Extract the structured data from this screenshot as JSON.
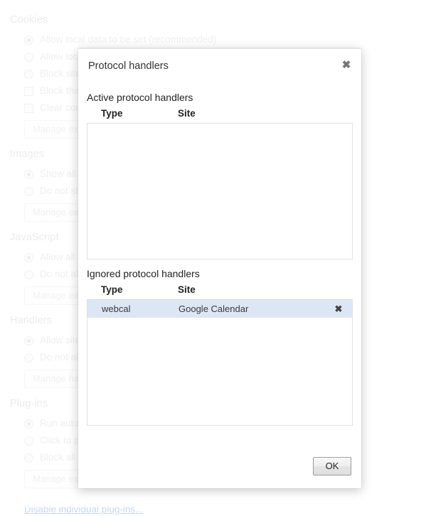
{
  "settings_page": {
    "sections": [
      {
        "title": "Cookies",
        "options": [
          {
            "control": "radio",
            "checked": true,
            "label": "Allow local data to be set (recommended)"
          },
          {
            "control": "radio",
            "checked": false,
            "label": "Allow local data to be set for the current session only"
          },
          {
            "control": "radio",
            "checked": false,
            "label": "Block sites from setting any data"
          },
          {
            "control": "checkbox",
            "checked": false,
            "label": "Block third-party cookies and site data"
          },
          {
            "control": "checkbox",
            "checked": false,
            "label": "Clear cookies and other site and plug-in data when I close my browser"
          }
        ],
        "button": "Manage exceptions..."
      },
      {
        "title": "Images",
        "options": [
          {
            "control": "radio",
            "checked": true,
            "label": "Show all images (recommended)"
          },
          {
            "control": "radio",
            "checked": false,
            "label": "Do not show any images"
          }
        ],
        "button": "Manage exceptions..."
      },
      {
        "title": "JavaScript",
        "options": [
          {
            "control": "radio",
            "checked": true,
            "label": "Allow all sites to run JavaScript (recommended)"
          },
          {
            "control": "radio",
            "checked": false,
            "label": "Do not allow any site to run JavaScript"
          }
        ],
        "button": "Manage exceptions..."
      },
      {
        "title": "Handlers",
        "options": [
          {
            "control": "radio",
            "checked": true,
            "label": "Allow sites to ask to become default handlers for protocols (recommended)"
          },
          {
            "control": "radio",
            "checked": false,
            "label": "Do not allow any site to handle protocols"
          }
        ],
        "button": "Manage handlers..."
      },
      {
        "title": "Plug-ins",
        "options": [
          {
            "control": "radio",
            "checked": true,
            "label": "Run automatically (recommended)"
          },
          {
            "control": "radio",
            "checked": false,
            "label": "Click to play"
          },
          {
            "control": "radio",
            "checked": false,
            "label": "Block all"
          }
        ],
        "button": "Manage exceptions..."
      }
    ],
    "plugin_link": "Disable individual plug-ins..."
  },
  "dialog": {
    "title": "Protocol handlers",
    "close_icon": "✖",
    "active": {
      "label": "Active protocol handlers",
      "columns": {
        "type": "Type",
        "site": "Site"
      },
      "rows": []
    },
    "ignored": {
      "label": "Ignored protocol handlers",
      "columns": {
        "type": "Type",
        "site": "Site"
      },
      "rows": [
        {
          "type": "webcal",
          "site": "Google Calendar",
          "selected": true,
          "remove_icon": "✖"
        }
      ]
    },
    "ok_label": "OK"
  },
  "colors": {
    "selection_blue": "#dde6f4",
    "dialog_bg": "#ffffff",
    "border_gray": "#e0e0e0",
    "text_primary": "#222222",
    "muted_text": "#d4d4d4",
    "link_blue": "#c8d6ee"
  }
}
